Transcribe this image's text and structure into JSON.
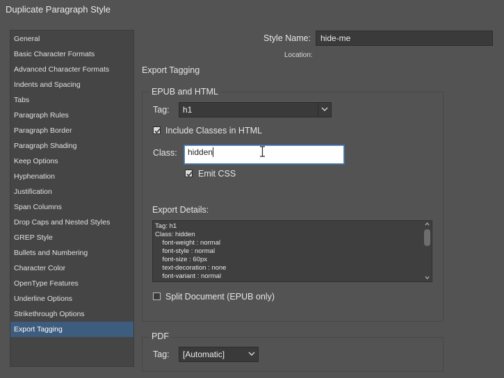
{
  "window": {
    "title": "Duplicate Paragraph Style"
  },
  "sidebar": {
    "items": [
      {
        "label": "General"
      },
      {
        "label": "Basic Character Formats"
      },
      {
        "label": "Advanced Character Formats"
      },
      {
        "label": "Indents and Spacing"
      },
      {
        "label": "Tabs"
      },
      {
        "label": "Paragraph Rules"
      },
      {
        "label": "Paragraph Border"
      },
      {
        "label": "Paragraph Shading"
      },
      {
        "label": "Keep Options"
      },
      {
        "label": "Hyphenation"
      },
      {
        "label": "Justification"
      },
      {
        "label": "Span Columns"
      },
      {
        "label": "Drop Caps and Nested Styles"
      },
      {
        "label": "GREP Style"
      },
      {
        "label": "Bullets and Numbering"
      },
      {
        "label": "Character Color"
      },
      {
        "label": "OpenType Features"
      },
      {
        "label": "Underline Options"
      },
      {
        "label": "Strikethrough Options"
      },
      {
        "label": "Export Tagging"
      }
    ],
    "selected": "Export Tagging"
  },
  "header": {
    "style_name_label": "Style Name:",
    "style_name_value": "hide-me",
    "location_label": "Location:"
  },
  "section": {
    "title": "Export Tagging"
  },
  "epub": {
    "group_label": "EPUB and HTML",
    "tag_label": "Tag:",
    "tag_value": "h1",
    "include_classes_label": "Include Classes in HTML",
    "include_classes_checked": true,
    "class_label": "Class:",
    "class_value": "hidden",
    "emit_css_label": "Emit CSS",
    "emit_css_checked": true,
    "export_details_label": "Export Details:",
    "export_details_lines": [
      "Tag: h1",
      "Class: hidden",
      "    font-weight : normal",
      "    font-style : normal",
      "    font-size : 60px",
      "    text-decoration : none",
      "    font-variant : normal"
    ],
    "split_document_label": "Split Document (EPUB only)",
    "split_document_checked": false
  },
  "pdf": {
    "group_label": "PDF",
    "tag_label": "Tag:",
    "tag_value": "[Automatic]"
  },
  "colors": {
    "background": "#535353",
    "sidebar_bg": "#454545",
    "selected_item": "#3d5c7e",
    "focus_border": "#5b86b8"
  }
}
